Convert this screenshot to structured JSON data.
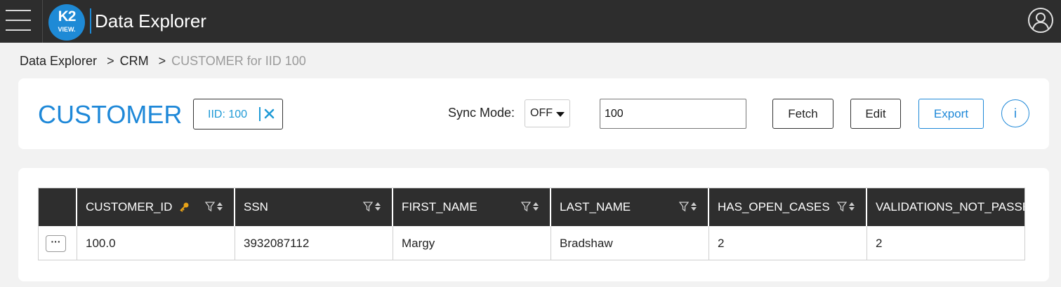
{
  "app": {
    "logo_text": "K2",
    "logo_sub": "VIEW.",
    "title": "Data Explorer"
  },
  "breadcrumb": {
    "items": [
      "Data Explorer",
      "CRM"
    ],
    "current": "CUSTOMER for IID 100",
    "separator": ">"
  },
  "header": {
    "entity": "CUSTOMER",
    "iid_chip": "IID: 100",
    "sync_label": "Sync Mode:",
    "sync_value": "OFF",
    "iid_input_value": "100",
    "fetch_label": "Fetch",
    "edit_label": "Edit",
    "export_label": "Export",
    "info_label": "i"
  },
  "table": {
    "columns": [
      "CUSTOMER_ID",
      "SSN",
      "FIRST_NAME",
      "LAST_NAME",
      "HAS_OPEN_CASES",
      "VALIDATIONS_NOT_PASSED"
    ],
    "row_menu": "···",
    "rows": [
      [
        "100.0",
        "3932087112",
        "Margy",
        "Bradshaw",
        "2",
        "2"
      ]
    ]
  },
  "colors": {
    "accent": "#1e88d8",
    "topbar": "#2d2d2d",
    "header": "#2e2e2e",
    "key": "#e8a317"
  },
  "icons": {
    "menu": "hamburger-icon",
    "user": "user-account-icon",
    "clear": "close-icon",
    "key": "key-icon",
    "filter": "filter-icon",
    "sort": "sort-icon"
  }
}
